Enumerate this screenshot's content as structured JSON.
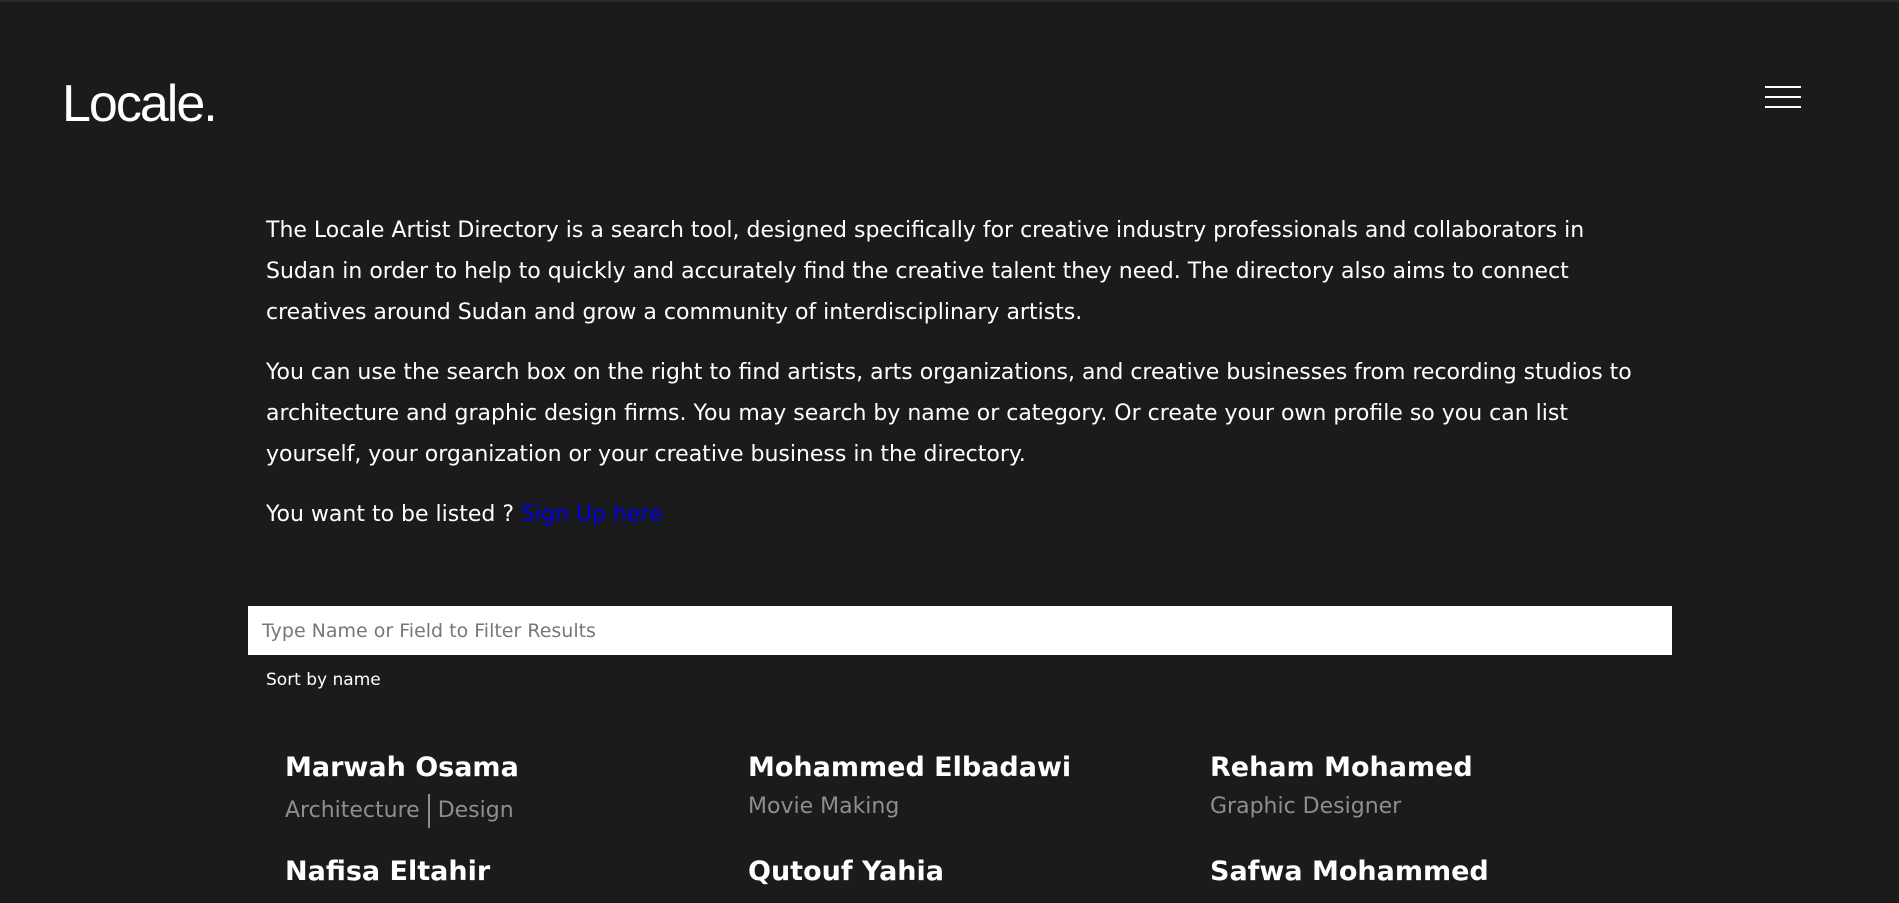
{
  "header": {
    "logo_text": "Locale.",
    "menu_icon": "hamburger-menu-icon"
  },
  "intro": {
    "paragraph_1": "The Locale Artist Directory is a search tool, designed specifically for creative industry professionals and collaborators in Sudan in order to help to quickly and accurately find the creative talent they need. The directory also aims to connect creatives around Sudan and grow a community of interdisciplinary artists.",
    "paragraph_2": "You can use the search box on the right to find artists, arts organizations, and creative businesses from recording studios to architecture and graphic design firms. You may search by name or category. Or create your own profile so you can list yourself, your organization or your creative business in the directory.",
    "signup_prompt": "You want to be listed ?",
    "signup_link": "Sign Up here"
  },
  "search": {
    "placeholder": "Type Name or Field to Filter Results",
    "value": ""
  },
  "sort": {
    "label": "Sort by name"
  },
  "artists": [
    {
      "name": "Marwah Osama",
      "category_1": "Architecture",
      "category_2": "Design"
    },
    {
      "name": "Mohammed Elbadawi",
      "category_1": "Movie Making",
      "category_2": ""
    },
    {
      "name": "Reham Mohamed",
      "category_1": "Graphic Designer",
      "category_2": ""
    },
    {
      "name": "Nafisa Eltahir",
      "category_1": "",
      "category_2": ""
    },
    {
      "name": "Qutouf Yahia",
      "category_1": "",
      "category_2": ""
    },
    {
      "name": "Safwa Mohammed",
      "category_1": "",
      "category_2": ""
    }
  ],
  "colors": {
    "background": "#1b1b1b",
    "text": "#ffffff",
    "muted": "#8e8e8e",
    "link": "#0000ee"
  }
}
